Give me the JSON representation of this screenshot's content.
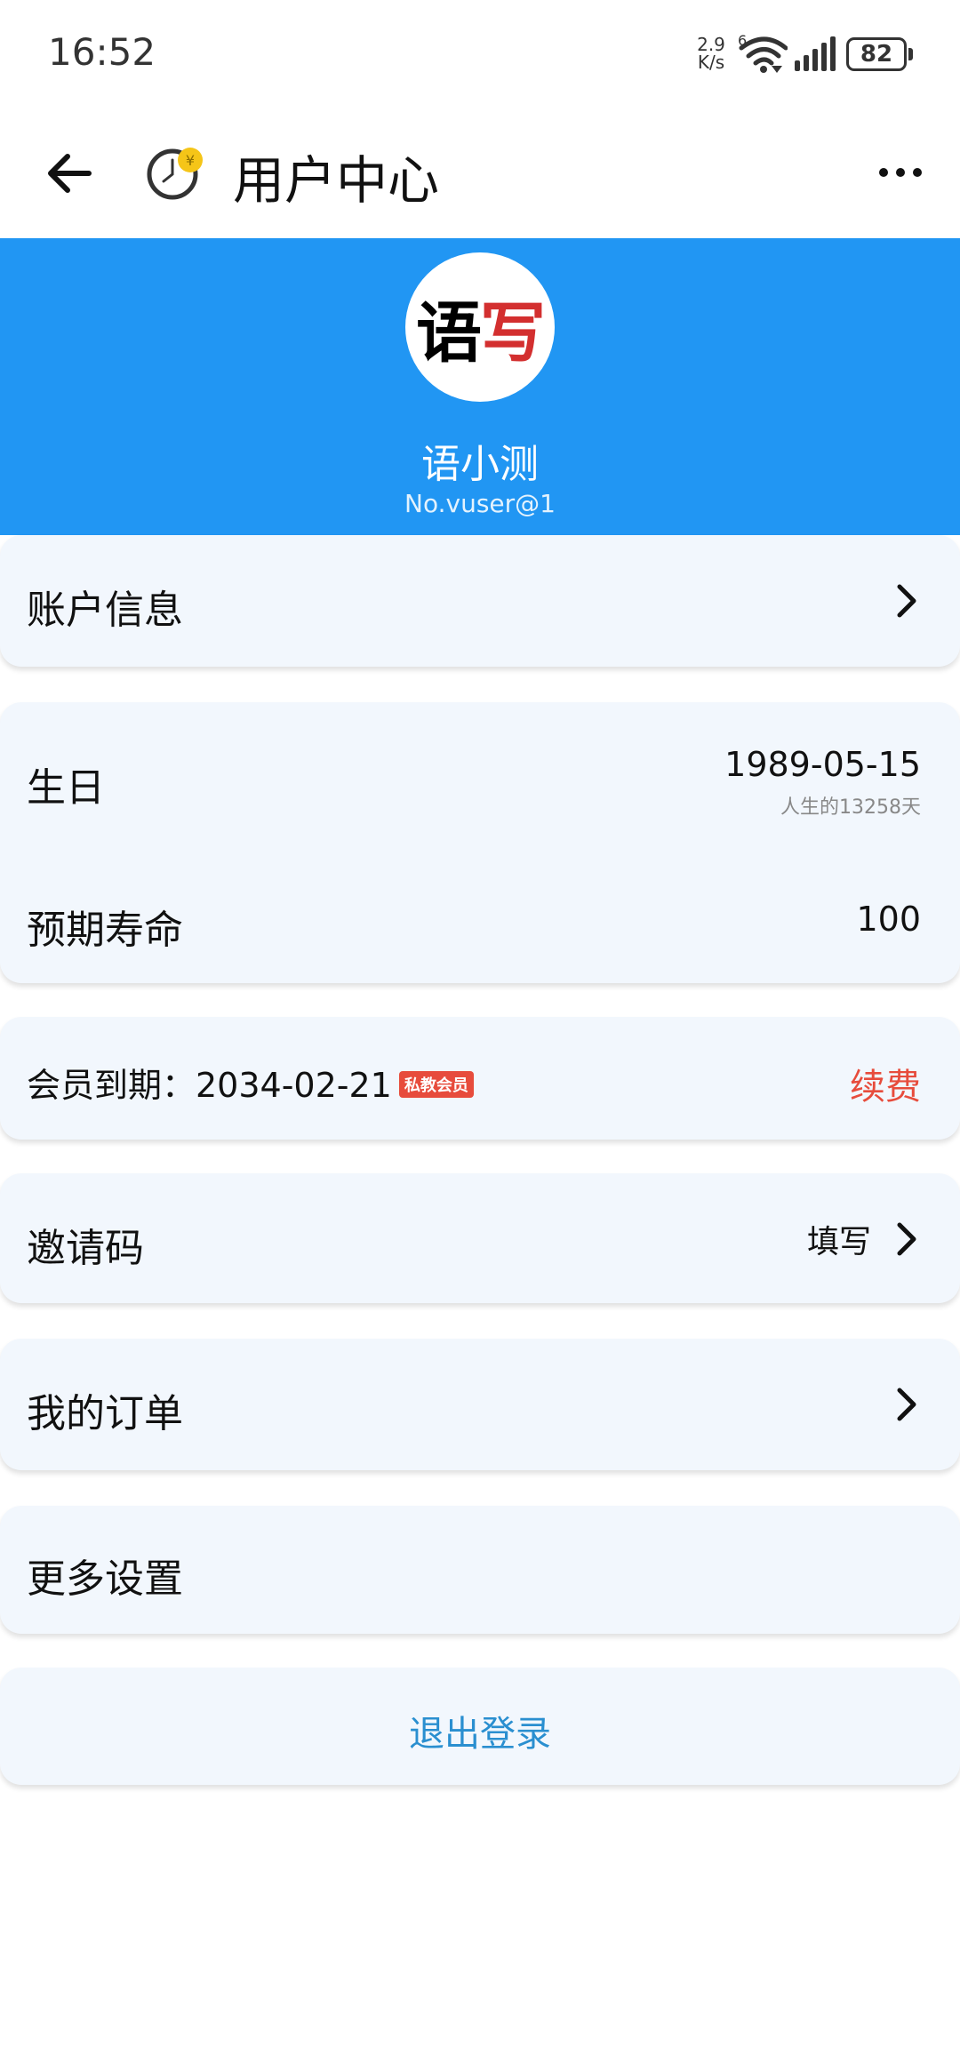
{
  "status_bar": {
    "time": "16:52",
    "net_speed_value": "2.9",
    "net_speed_unit": "K/s",
    "wifi_badge": "6",
    "battery": "82"
  },
  "app_bar": {
    "title": "用户中心",
    "back_icon": "arrow-left-icon",
    "logo_icon": "clock-coin-icon",
    "more_icon": "more-horizontal-icon"
  },
  "profile": {
    "avatar_text_black": "语",
    "avatar_text_red_mix": "写",
    "name": "语小测",
    "id": "No.vuser@1",
    "background_color": "#2196f3"
  },
  "account": {
    "label": "账户信息"
  },
  "birthday": {
    "label": "生日",
    "value": "1989-05-15",
    "sub": "人生的13258天"
  },
  "life": {
    "label": "预期寿命",
    "value": "100"
  },
  "membership": {
    "label": "会员到期：2034-02-21",
    "badge": "私教会员",
    "action": "续费",
    "action_color": "#e74c3c"
  },
  "invite": {
    "label": "邀请码",
    "action": "填写"
  },
  "orders": {
    "label": "我的订单"
  },
  "settings": {
    "label": "更多设置"
  },
  "logout": {
    "label": "退出登录",
    "color": "#2a8fd0"
  }
}
